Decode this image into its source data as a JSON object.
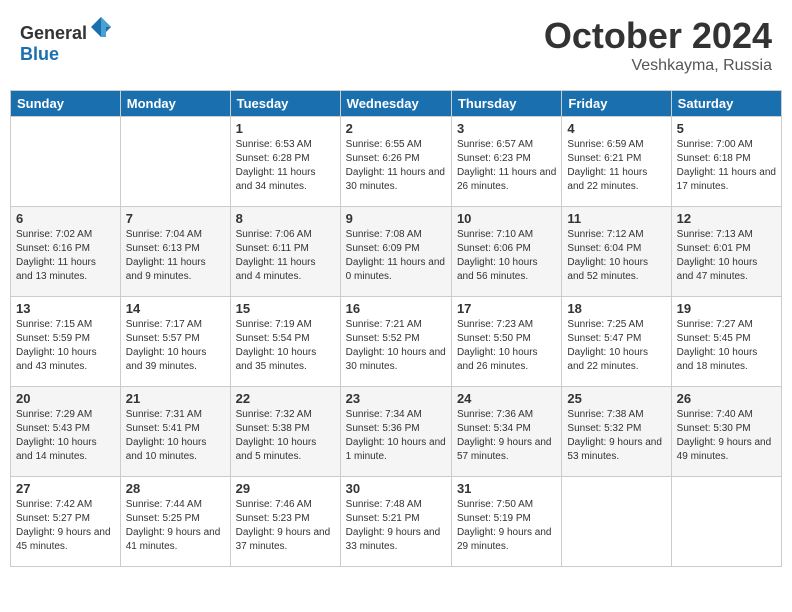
{
  "header": {
    "logo_general": "General",
    "logo_blue": "Blue",
    "month": "October 2024",
    "location": "Veshkayma, Russia"
  },
  "weekdays": [
    "Sunday",
    "Monday",
    "Tuesday",
    "Wednesday",
    "Thursday",
    "Friday",
    "Saturday"
  ],
  "weeks": [
    [
      {
        "day": "",
        "info": ""
      },
      {
        "day": "",
        "info": ""
      },
      {
        "day": "1",
        "info": "Sunrise: 6:53 AM\nSunset: 6:28 PM\nDaylight: 11 hours and 34 minutes."
      },
      {
        "day": "2",
        "info": "Sunrise: 6:55 AM\nSunset: 6:26 PM\nDaylight: 11 hours and 30 minutes."
      },
      {
        "day": "3",
        "info": "Sunrise: 6:57 AM\nSunset: 6:23 PM\nDaylight: 11 hours and 26 minutes."
      },
      {
        "day": "4",
        "info": "Sunrise: 6:59 AM\nSunset: 6:21 PM\nDaylight: 11 hours and 22 minutes."
      },
      {
        "day": "5",
        "info": "Sunrise: 7:00 AM\nSunset: 6:18 PM\nDaylight: 11 hours and 17 minutes."
      }
    ],
    [
      {
        "day": "6",
        "info": "Sunrise: 7:02 AM\nSunset: 6:16 PM\nDaylight: 11 hours and 13 minutes."
      },
      {
        "day": "7",
        "info": "Sunrise: 7:04 AM\nSunset: 6:13 PM\nDaylight: 11 hours and 9 minutes."
      },
      {
        "day": "8",
        "info": "Sunrise: 7:06 AM\nSunset: 6:11 PM\nDaylight: 11 hours and 4 minutes."
      },
      {
        "day": "9",
        "info": "Sunrise: 7:08 AM\nSunset: 6:09 PM\nDaylight: 11 hours and 0 minutes."
      },
      {
        "day": "10",
        "info": "Sunrise: 7:10 AM\nSunset: 6:06 PM\nDaylight: 10 hours and 56 minutes."
      },
      {
        "day": "11",
        "info": "Sunrise: 7:12 AM\nSunset: 6:04 PM\nDaylight: 10 hours and 52 minutes."
      },
      {
        "day": "12",
        "info": "Sunrise: 7:13 AM\nSunset: 6:01 PM\nDaylight: 10 hours and 47 minutes."
      }
    ],
    [
      {
        "day": "13",
        "info": "Sunrise: 7:15 AM\nSunset: 5:59 PM\nDaylight: 10 hours and 43 minutes."
      },
      {
        "day": "14",
        "info": "Sunrise: 7:17 AM\nSunset: 5:57 PM\nDaylight: 10 hours and 39 minutes."
      },
      {
        "day": "15",
        "info": "Sunrise: 7:19 AM\nSunset: 5:54 PM\nDaylight: 10 hours and 35 minutes."
      },
      {
        "day": "16",
        "info": "Sunrise: 7:21 AM\nSunset: 5:52 PM\nDaylight: 10 hours and 30 minutes."
      },
      {
        "day": "17",
        "info": "Sunrise: 7:23 AM\nSunset: 5:50 PM\nDaylight: 10 hours and 26 minutes."
      },
      {
        "day": "18",
        "info": "Sunrise: 7:25 AM\nSunset: 5:47 PM\nDaylight: 10 hours and 22 minutes."
      },
      {
        "day": "19",
        "info": "Sunrise: 7:27 AM\nSunset: 5:45 PM\nDaylight: 10 hours and 18 minutes."
      }
    ],
    [
      {
        "day": "20",
        "info": "Sunrise: 7:29 AM\nSunset: 5:43 PM\nDaylight: 10 hours and 14 minutes."
      },
      {
        "day": "21",
        "info": "Sunrise: 7:31 AM\nSunset: 5:41 PM\nDaylight: 10 hours and 10 minutes."
      },
      {
        "day": "22",
        "info": "Sunrise: 7:32 AM\nSunset: 5:38 PM\nDaylight: 10 hours and 5 minutes."
      },
      {
        "day": "23",
        "info": "Sunrise: 7:34 AM\nSunset: 5:36 PM\nDaylight: 10 hours and 1 minute."
      },
      {
        "day": "24",
        "info": "Sunrise: 7:36 AM\nSunset: 5:34 PM\nDaylight: 9 hours and 57 minutes."
      },
      {
        "day": "25",
        "info": "Sunrise: 7:38 AM\nSunset: 5:32 PM\nDaylight: 9 hours and 53 minutes."
      },
      {
        "day": "26",
        "info": "Sunrise: 7:40 AM\nSunset: 5:30 PM\nDaylight: 9 hours and 49 minutes."
      }
    ],
    [
      {
        "day": "27",
        "info": "Sunrise: 7:42 AM\nSunset: 5:27 PM\nDaylight: 9 hours and 45 minutes."
      },
      {
        "day": "28",
        "info": "Sunrise: 7:44 AM\nSunset: 5:25 PM\nDaylight: 9 hours and 41 minutes."
      },
      {
        "day": "29",
        "info": "Sunrise: 7:46 AM\nSunset: 5:23 PM\nDaylight: 9 hours and 37 minutes."
      },
      {
        "day": "30",
        "info": "Sunrise: 7:48 AM\nSunset: 5:21 PM\nDaylight: 9 hours and 33 minutes."
      },
      {
        "day": "31",
        "info": "Sunrise: 7:50 AM\nSunset: 5:19 PM\nDaylight: 9 hours and 29 minutes."
      },
      {
        "day": "",
        "info": ""
      },
      {
        "day": "",
        "info": ""
      }
    ]
  ]
}
